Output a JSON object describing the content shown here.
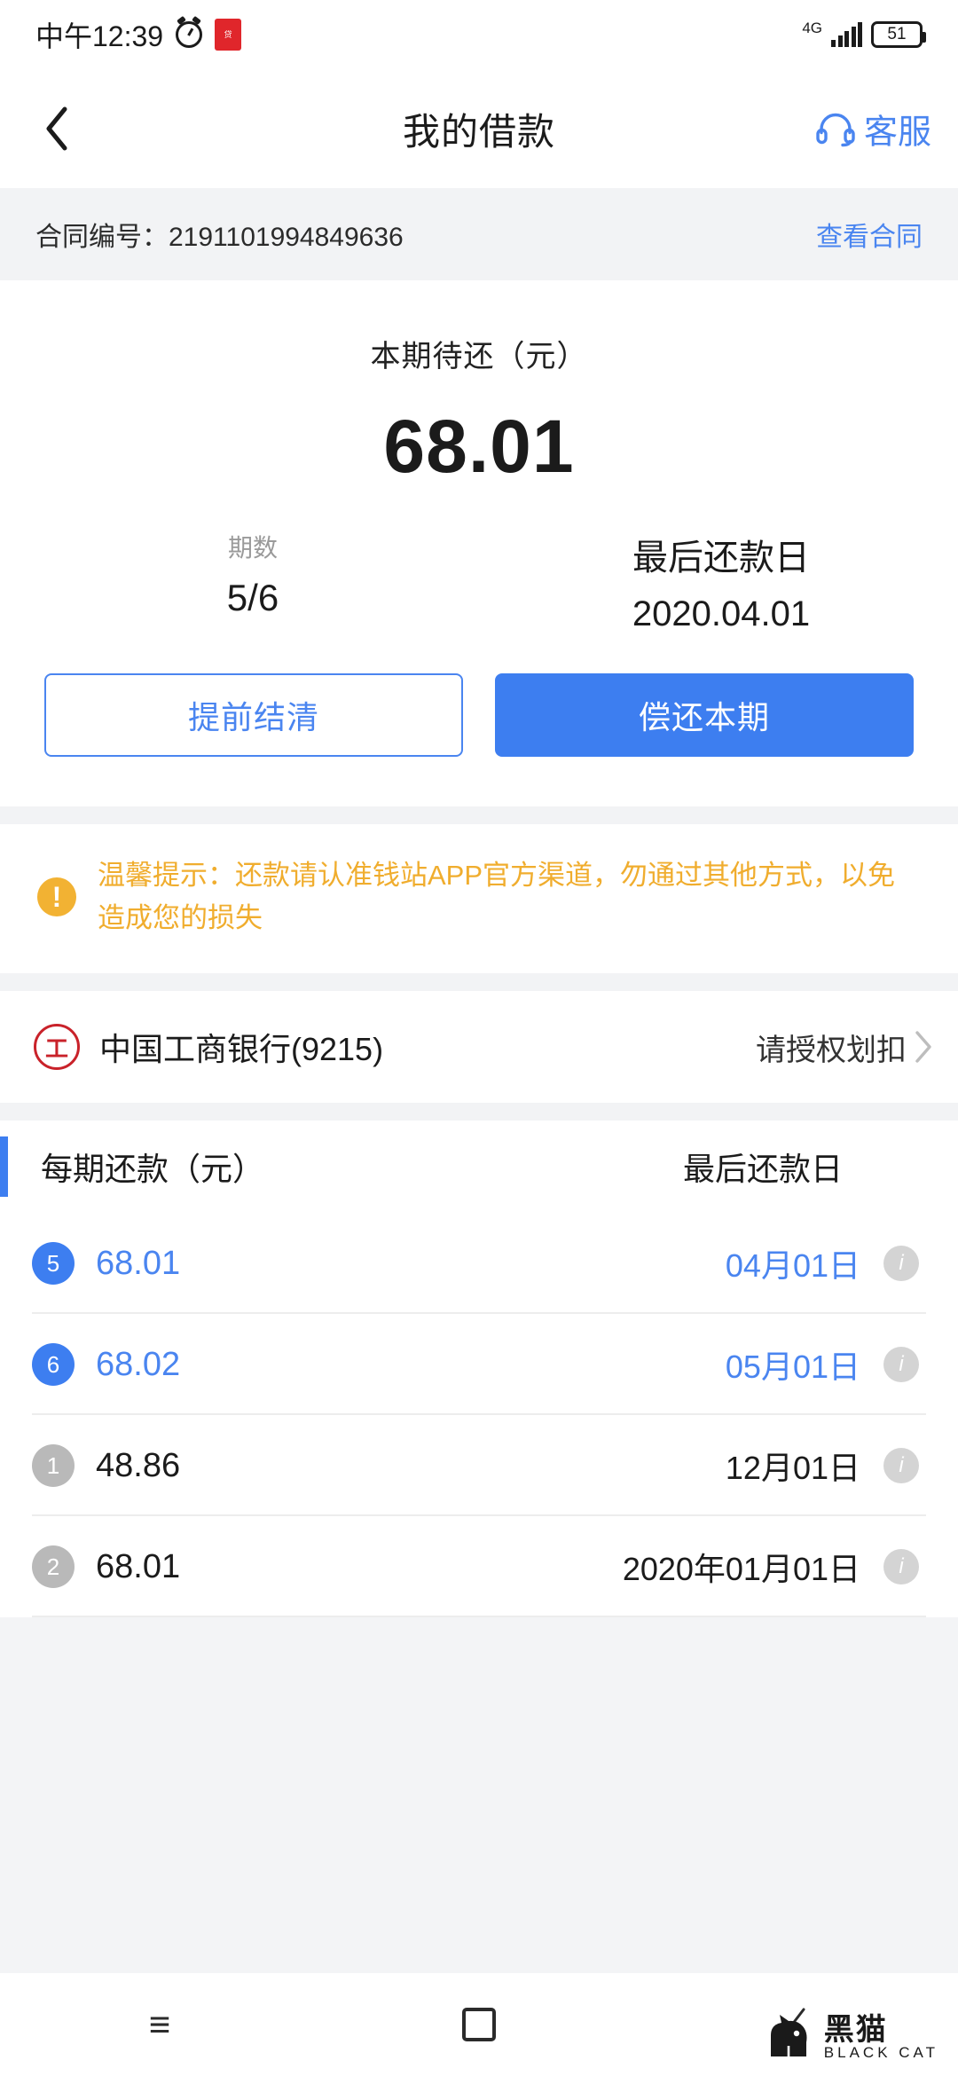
{
  "statusbar": {
    "time": "中午12:39",
    "alarm_icon": "alarm-clock-icon",
    "app_icon": "red-app-icon",
    "app_icon_text": "贷",
    "network": "4G",
    "battery": "51"
  },
  "header": {
    "back_icon": "back-chevron-icon",
    "title": "我的借款",
    "service_icon": "headset-icon",
    "service_label": "客服"
  },
  "contract": {
    "label": "合同编号：2191101994849636",
    "view_link": "查看合同"
  },
  "summary": {
    "due_label": "本期待还（元）",
    "due_amount": "68.01",
    "term_label": "期数",
    "term_value": "5/6",
    "date_label": "最后还款日",
    "date_value": "2020.04.01",
    "btn_settle": "提前结清",
    "btn_repay": "偿还本期"
  },
  "tip": {
    "icon": "warning-exclamation-icon",
    "icon_glyph": "!",
    "text": "温馨提示：还款请认准钱站APP官方渠道，勿通过其他方式，以免造成您的损失"
  },
  "bank": {
    "logo_icon": "icbc-bank-icon",
    "logo_glyph": "工",
    "name": "中国工商银行(9215)",
    "status": "请授权划扣",
    "chevron_icon": "chevron-right-icon"
  },
  "schedule": {
    "col_amount": "每期还款（元）",
    "col_date": "最后还款日",
    "info_icon": "info-icon",
    "info_glyph": "i",
    "rows": [
      {
        "no": "5",
        "amount": "68.01",
        "date": "04月01日",
        "state": "active"
      },
      {
        "no": "6",
        "amount": "68.02",
        "date": "05月01日",
        "state": "active"
      },
      {
        "no": "1",
        "amount": "48.86",
        "date": "12月01日",
        "state": "past"
      },
      {
        "no": "2",
        "amount": "68.01",
        "date": "2020年01月01日",
        "state": "past"
      }
    ]
  },
  "bottomnav": {
    "menu_icon": "menu-icon",
    "home_icon": "home-square-icon",
    "back_icon": "back-chevron-icon"
  },
  "watermark": {
    "cn": "黑猫",
    "en": "BLACK CAT"
  },
  "colors": {
    "accent": "#3d7ef0",
    "link": "#4a85f0",
    "warning": "#f0ad2e",
    "bank_red": "#c9222a"
  }
}
